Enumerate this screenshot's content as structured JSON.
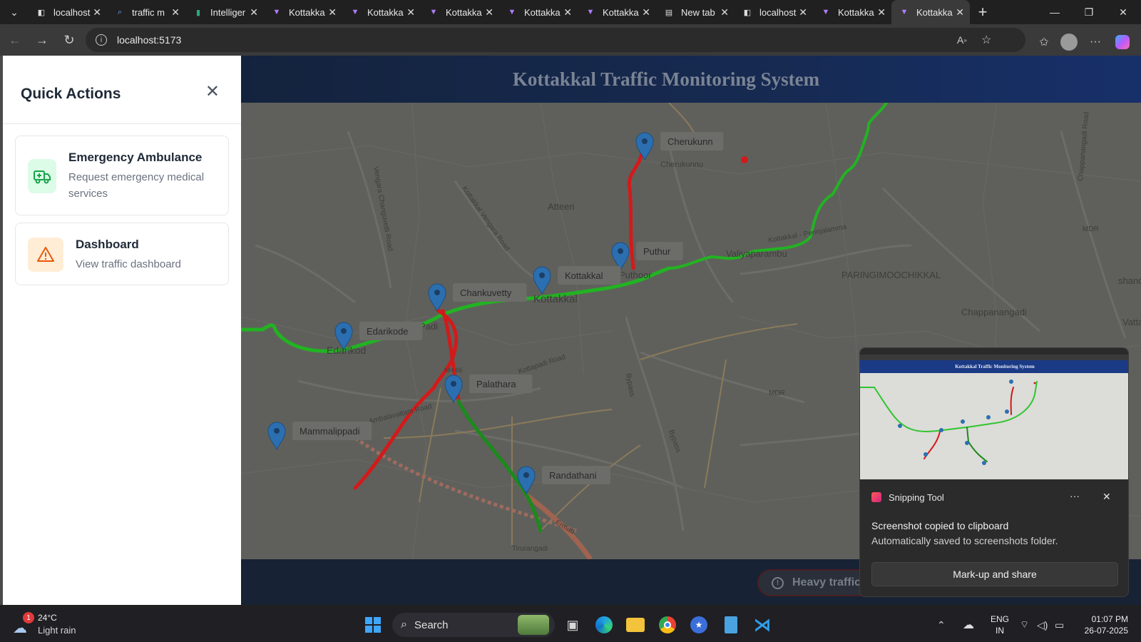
{
  "browser": {
    "tabs": [
      {
        "title": "localhost",
        "icon": "page-icon"
      },
      {
        "title": "traffic m",
        "icon": "search-icon"
      },
      {
        "title": "Intelliger",
        "icon": "intel-icon"
      },
      {
        "title": "Kottakka",
        "icon": "vite-icon"
      },
      {
        "title": "Kottakka",
        "icon": "vite-icon"
      },
      {
        "title": "Kottakka",
        "icon": "vite-icon"
      },
      {
        "title": "Kottakka",
        "icon": "vite-icon"
      },
      {
        "title": "Kottakka",
        "icon": "vite-icon"
      },
      {
        "title": "New tab",
        "icon": "newtab-icon"
      },
      {
        "title": "localhost",
        "icon": "page-icon"
      },
      {
        "title": "Kottakka",
        "icon": "vite-icon"
      },
      {
        "title": "Kottakka",
        "icon": "vite-icon",
        "active": true
      }
    ],
    "address": "localhost:5173"
  },
  "app": {
    "title": "Kottakkal Traffic Monitoring System",
    "alert_text": "Heavy traffic"
  },
  "quick_actions": {
    "title": "Quick Actions",
    "items": [
      {
        "title": "Emergency Ambulance",
        "description": "Request emergency medical services",
        "icon": "ambulance-icon",
        "color": "#16a34a"
      },
      {
        "title": "Dashboard",
        "description": "View traffic dashboard",
        "icon": "warning-icon",
        "color": "#ea580c"
      }
    ]
  },
  "map": {
    "markers": [
      "Cherukunn",
      "Puthur",
      "Kottakkal",
      "Chankuvetty",
      "Edarikode",
      "Palathara",
      "Mammalippadi",
      "Randathani"
    ],
    "place_labels": [
      "Cherukunnu",
      "Atteeri",
      "Valiyaparambu",
      "PARINGIMOOCHIKKAL",
      "Chappanangadi",
      "Kottakkal",
      "Edarikod",
      "Padi",
      "Puthoor",
      "MDR",
      "shandhi",
      "Vattap",
      "Tirurangadi",
      "Bypass",
      "NH 66"
    ],
    "road_labels": [
      "Kottakkal Vengara Road",
      "Vengara Changuvetti Road",
      "Kottakkal - Perinjalamma",
      "Ambalavattam Road",
      "Kottapadi Road",
      "Chappanangadi Road",
      "Ermad"
    ],
    "colors": {
      "congested": "#d31a1a",
      "clear": "#22b322",
      "moderate": "#1c8a1c",
      "marker": "#2c6fb0"
    }
  },
  "snipping_toast": {
    "app_name": "Snipping Tool",
    "line1": "Screenshot copied to clipboard",
    "line2": "Automatically saved to screenshots folder.",
    "button": "Mark-up and share",
    "thumb_title": "Kottakkal Traffic Monitoring System"
  },
  "taskbar": {
    "weather_temp": "24°C",
    "weather_desc": "Light rain",
    "weather_badge": "1",
    "search_placeholder": "Search",
    "lang_top": "ENG",
    "lang_bottom": "IN",
    "time": "01:07 PM",
    "date": "26-07-2025"
  }
}
